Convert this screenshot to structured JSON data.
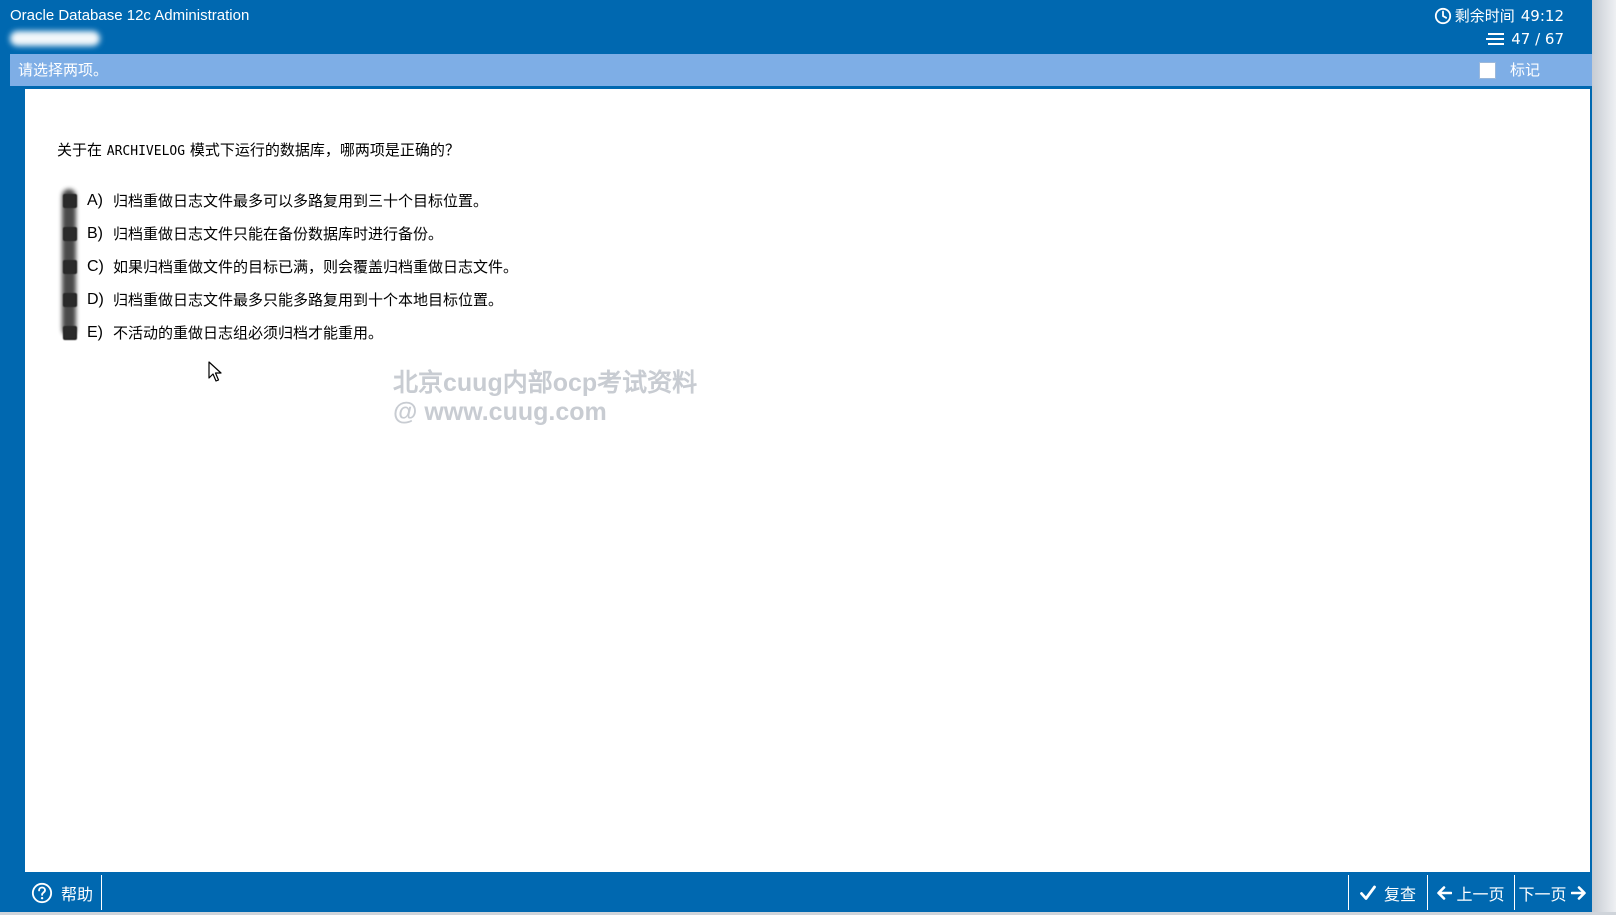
{
  "window": {
    "title": "Oracle Database 12c Administration"
  },
  "header": {
    "timer_label": "剩余时间",
    "timer_value": "49:12",
    "progress": "47 / 67"
  },
  "instruction": {
    "text": "请选择两项。",
    "mark_label": "标记"
  },
  "question": {
    "prefix": "关于在 ",
    "code": "ARCHIVELOG",
    "suffix": " 模式下运行的数据库，哪两项是正确的？"
  },
  "options": [
    {
      "letter": "A)",
      "text": "归档重做日志文件最多可以多路复用到三十个目标位置。"
    },
    {
      "letter": "B)",
      "text": "归档重做日志文件只能在备份数据库时进行备份。"
    },
    {
      "letter": "C)",
      "text": "如果归档重做文件的目标已满，则会覆盖归档重做日志文件。"
    },
    {
      "letter": "D)",
      "text": "归档重做日志文件最多只能多路复用到十个本地目标位置。"
    },
    {
      "letter": "E)",
      "text": "不活动的重做日志组必须归档才能重用。"
    }
  ],
  "watermark": {
    "line1": "北京cuug内部ocp考试资料",
    "line2": "@ www.cuug.com"
  },
  "footer": {
    "help_label": "帮助",
    "review_label": "复查",
    "prev_label": "上一页",
    "next_label": "下一页"
  },
  "colors": {
    "primary_blue": "#0068b0",
    "instruction_bar": "#7eaee6",
    "content_bg": "#ffffff"
  }
}
